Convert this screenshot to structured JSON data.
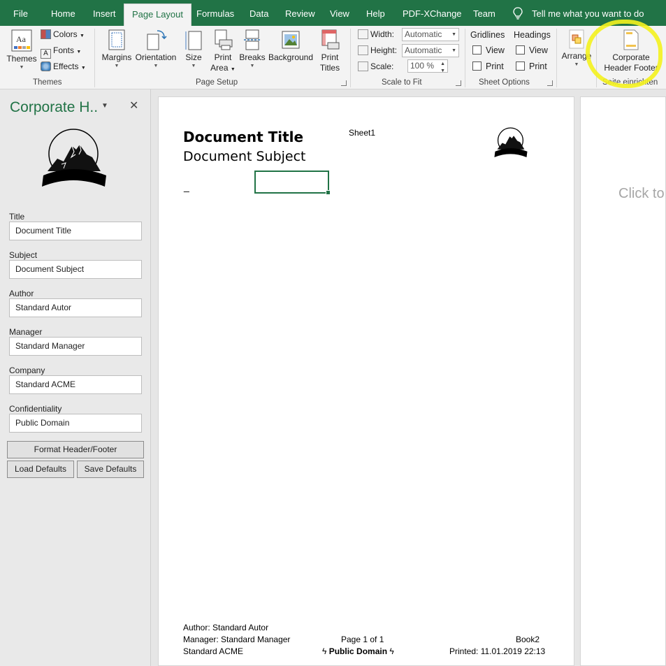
{
  "tabs": {
    "file": "File",
    "home": "Home",
    "insert": "Insert",
    "page_layout": "Page Layout",
    "formulas": "Formulas",
    "data": "Data",
    "review": "Review",
    "view": "View",
    "help": "Help",
    "pdf_xchange": "PDF-XChange",
    "team": "Team",
    "tell_me": "Tell me what you want to do"
  },
  "ribbon": {
    "themes": {
      "themes": "Themes",
      "colors": "Colors",
      "fonts": "Fonts",
      "effects": "Effects",
      "group": "Themes"
    },
    "page_setup": {
      "margins": "Margins",
      "orientation": "Orientation",
      "size": "Size",
      "print_area_1": "Print",
      "print_area_2": "Area",
      "breaks": "Breaks",
      "background": "Background",
      "print_titles_1": "Print",
      "print_titles_2": "Titles",
      "group": "Page Setup"
    },
    "scale_to_fit": {
      "width_label": "Width:",
      "width_value": "Automatic",
      "height_label": "Height:",
      "height_value": "Automatic",
      "scale_label": "Scale:",
      "scale_value": "100 %",
      "group": "Scale to Fit"
    },
    "sheet_options": {
      "gridlines": "Gridlines",
      "headings": "Headings",
      "view": "View",
      "print": "Print",
      "group": "Sheet Options"
    },
    "arrange": {
      "label": "Arrange"
    },
    "corporate": {
      "line1": "Corporate",
      "line2": "Header Footer",
      "group": "Seite einrichten"
    }
  },
  "pane": {
    "title": "Corporate H..",
    "fields": [
      {
        "label": "Title",
        "value": "Document Title"
      },
      {
        "label": "Subject",
        "value": "Document Subject"
      },
      {
        "label": "Author",
        "value": "Standard Autor"
      },
      {
        "label": "Manager",
        "value": "Standard Manager"
      },
      {
        "label": "Company",
        "value": "Standard ACME"
      },
      {
        "label": "Confidentiality",
        "value": "Public Domain"
      }
    ],
    "format_button": "Format Header/Footer",
    "load_button": "Load Defaults",
    "save_button": "Save Defaults"
  },
  "sheet": {
    "header_title": "Document Title",
    "header_subject": "Document Subject",
    "sheet_name": "Sheet1",
    "cell_text": "_",
    "footer": {
      "author": "Author: Standard Autor",
      "manager": "Manager: Standard Manager",
      "company": "Standard ACME",
      "page": "Page 1 of 1",
      "confidentiality": "Public Domain",
      "book": "Book2",
      "printed": "Printed: 11.01.2019 22:13"
    },
    "next_page_hint": "Click to"
  },
  "colors": {
    "accent": "#217346",
    "highlight": "#f4f21e"
  }
}
